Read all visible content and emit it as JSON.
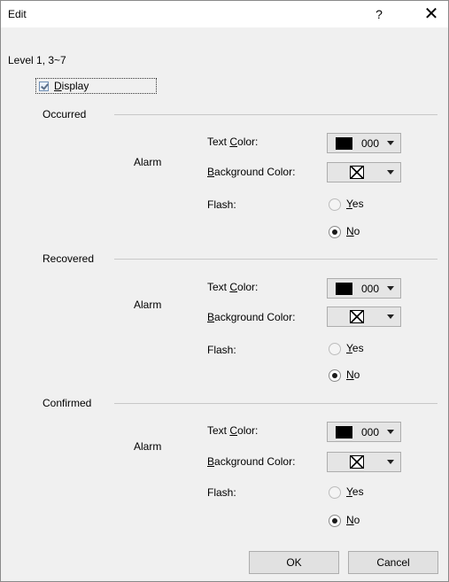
{
  "window": {
    "title": "Edit",
    "help_label": "?",
    "close_label": "✕"
  },
  "level_label": "Level 1, 3~7",
  "display_checkbox": {
    "label_prefix": "",
    "label_u": "D",
    "label_rest": "isplay",
    "checked": true
  },
  "sections": [
    {
      "title": "Occurred",
      "alarm_label": "Alarm",
      "text_color": {
        "label_pre": "Text ",
        "label_u": "C",
        "label_rest": "olor:",
        "swatch": "#000000",
        "value": "000"
      },
      "background_color": {
        "label_u": "B",
        "label_rest": "ackground Color:",
        "value": "none"
      },
      "flash": {
        "label": "Flash:",
        "yes_u": "Y",
        "yes_rest": "es",
        "no_u": "N",
        "no_rest": "o",
        "selected": "No"
      }
    },
    {
      "title": "Recovered",
      "alarm_label": "Alarm",
      "text_color": {
        "label_pre": "Text ",
        "label_u": "C",
        "label_rest": "olor:",
        "swatch": "#000000",
        "value": "000"
      },
      "background_color": {
        "label_u": "B",
        "label_rest": "ackground Color:",
        "value": "none"
      },
      "flash": {
        "label": "Flash:",
        "yes_u": "Y",
        "yes_rest": "es",
        "no_u": "N",
        "no_rest": "o",
        "selected": "No"
      }
    },
    {
      "title": "Confirmed",
      "alarm_label": "Alarm",
      "text_color": {
        "label_pre": "Text ",
        "label_u": "C",
        "label_rest": "olor:",
        "swatch": "#000000",
        "value": "000"
      },
      "background_color": {
        "label_u": "B",
        "label_rest": "ackground Color:",
        "value": "none"
      },
      "flash": {
        "label": "Flash:",
        "yes_u": "Y",
        "yes_rest": "es",
        "no_u": "N",
        "no_rest": "o",
        "selected": "No"
      }
    }
  ],
  "buttons": {
    "ok": "OK",
    "cancel": "Cancel"
  }
}
